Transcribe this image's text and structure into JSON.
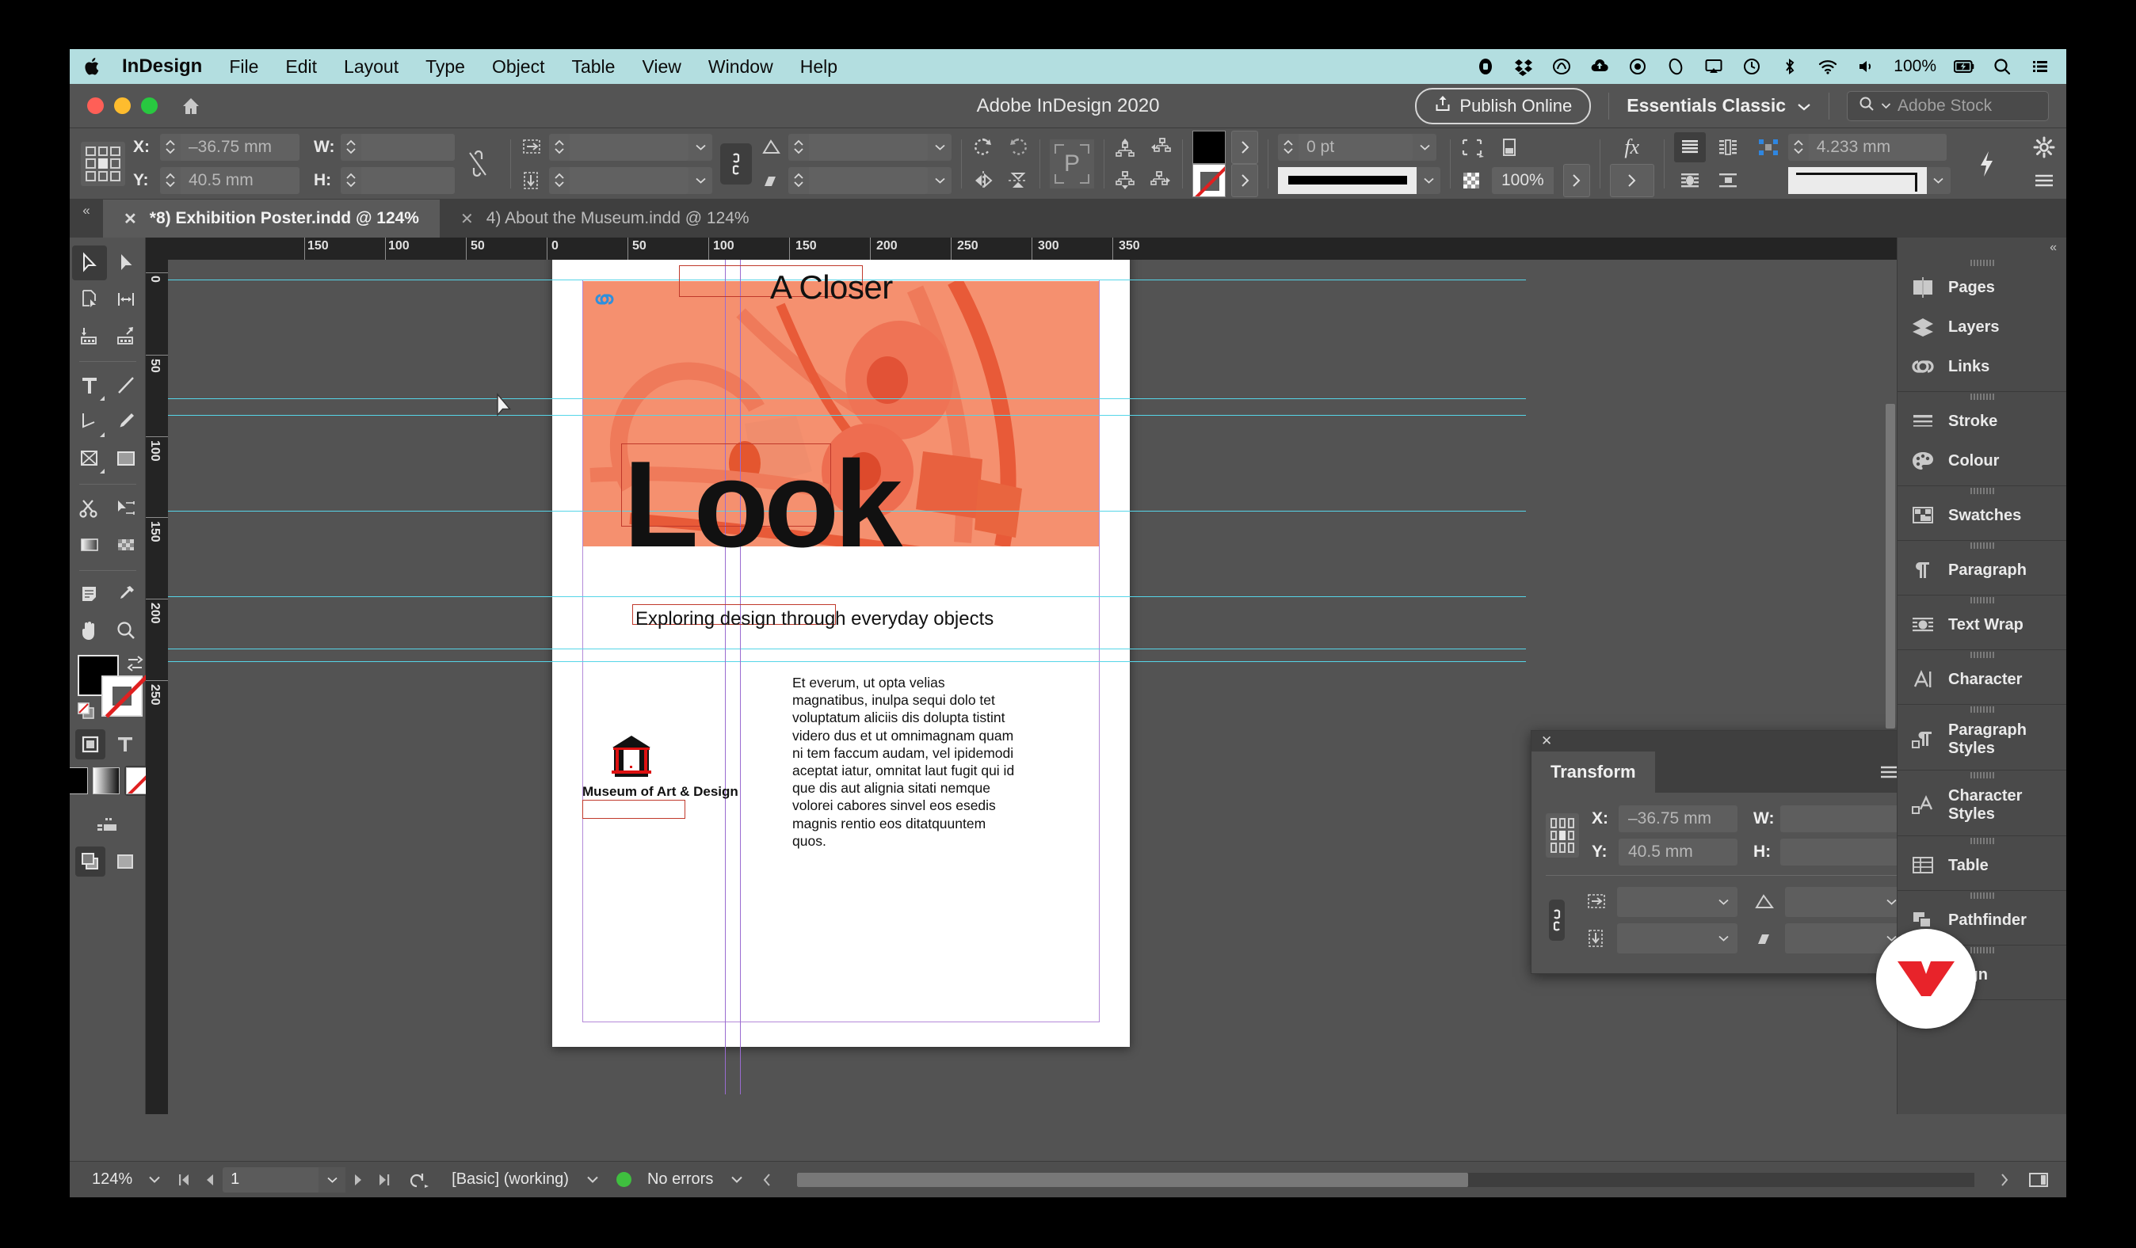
{
  "menubar": {
    "apple_icon": "apple-icon",
    "items": [
      "InDesign",
      "File",
      "Edit",
      "Layout",
      "Type",
      "Object",
      "Table",
      "View",
      "Window",
      "Help"
    ],
    "status_icons": [
      "screen-record-icon",
      "dropbox-icon",
      "creative-cloud-icon",
      "cloud-upload-icon",
      "backup-icon",
      "ellipsis-icon",
      "airplay-icon",
      "time-machine-icon",
      "bluetooth-icon",
      "wifi-icon",
      "volume-icon"
    ],
    "battery_percent": "100%",
    "battery_icon": "battery-charging-icon",
    "search_icon": "spotlight-search-icon",
    "control_center_icon": "control-center-icon"
  },
  "titlebar": {
    "title": "Adobe InDesign 2020",
    "home_icon": "home-icon",
    "publish_label": "Publish Online",
    "publish_icon": "share-upload-icon",
    "workspace": "Essentials Classic",
    "workspace_chevron": "chevron-down-icon",
    "search_placeholder": "Adobe Stock",
    "search_icon": "search-icon"
  },
  "control_panel": {
    "reference_point_icon": "reference-point-proxy",
    "x_label": "X:",
    "x_value": "–36.75 mm",
    "y_label": "Y:",
    "y_value": "40.5 mm",
    "w_label": "W:",
    "w_value": "",
    "h_label": "H:",
    "h_value": "",
    "constrain_wh_icon": "chain-broken-icon",
    "scale_x_icon": "scale-horizontal-icon",
    "scale_y_icon": "scale-vertical-icon",
    "scale_x_value": "",
    "scale_y_value": "",
    "constrain_scale_icon": "chain-link-icon",
    "rotation_icon": "rotation-angle-icon",
    "rotation_value": "",
    "shear_icon": "shear-icon",
    "shear_value": "",
    "rotate_cw_icon": "rotate-clockwise-icon",
    "rotate_ccw_icon": "rotate-counterclockwise-icon",
    "flip_h_icon": "flip-horizontal-icon",
    "flip_v_icon": "flip-vertical-icon",
    "placeholder_icon": "p-placeholder-icon",
    "select_container_icon": "select-container-icon",
    "select_content_icon": "select-content-icon",
    "select_prev_icon": "select-previous-icon",
    "select_next_icon": "select-next-icon",
    "fill_swatch_color": "#000000",
    "stroke_swatch": "none",
    "stroke_weight": "0 pt",
    "stroke_type": "solid-line",
    "opacity": "100%",
    "opacity_icon": "transparency-checker-icon",
    "effects_icon": "fx-icon",
    "text_wrap_none_icon": "wrap-none-icon",
    "text_wrap_bbox_icon": "wrap-bounding-box-icon",
    "text_wrap_shape_icon": "wrap-object-shape-icon",
    "text_wrap_jump_icon": "wrap-jump-object-icon",
    "corner_icon": "corner-options-icon",
    "corner_value": "4.233 mm",
    "corner_shape": "corner-shape-preview",
    "quick_apply_icon": "lightning-quick-apply-icon",
    "gear_icon": "gear-icon",
    "panel_menu_icon": "hamburger-menu-icon"
  },
  "tabs": {
    "collapse_icon": "collapse-chevrons-icon",
    "items": [
      {
        "label": "*8) Exhibition Poster.indd @ 124%",
        "active": true,
        "close_icon": "close-icon"
      },
      {
        "label": "4) About the Museum.indd @ 124%",
        "active": false,
        "close_icon": "close-icon"
      }
    ]
  },
  "toolbox": {
    "tools": [
      [
        "selection-tool",
        "direct-selection-tool"
      ],
      [
        "page-tool",
        "gap-tool"
      ],
      [
        "content-collector-tool",
        "content-placer-tool"
      ],
      [
        "type-tool",
        "line-tool"
      ],
      [
        "pen-tool",
        "pencil-tool"
      ],
      [
        "frame-tool",
        "rectangle-tool"
      ],
      [
        "scissors-tool",
        "free-transform-tool"
      ],
      [
        "gradient-swatch-tool",
        "gradient-feather-tool"
      ],
      [
        "note-tool",
        "eyedropper-tool"
      ],
      [
        "hand-tool",
        "zoom-tool"
      ]
    ],
    "active_tool": "selection-tool",
    "fill_color": "#000000",
    "stroke_color": "none",
    "formatting_affects_container_icon": "affects-container-icon",
    "formatting_affects_text_icon": "affects-text-icon",
    "apply_color_icon": "apply-color-icon",
    "apply_gradient_icon": "apply-gradient-icon",
    "apply_none_icon": "apply-none-icon",
    "screen_mode_icon": "normal-view-mode-icon",
    "preview_mode_icon": "preview-mode-icon"
  },
  "rulers": {
    "horizontal_labels": [
      "150",
      "100",
      "50",
      "0",
      "50",
      "100",
      "150",
      "200",
      "250",
      "300",
      "350"
    ],
    "vertical_labels": [
      "0",
      "50",
      "100",
      "150",
      "200",
      "250"
    ],
    "units": "mm"
  },
  "document": {
    "headline_top": "A Closer",
    "headline_main": "Look",
    "subtitle": "Exploring design through everyday objects",
    "body_text": "Et everum, ut opta velias magnatibus, inulpa sequi dolo tet voluptatum aliciis dis dolupta tistint videro dus et ut omnimagnam quam ni tem faccum audam, vel ipidemodi aceptat iatur, omnitat laut fugit qui id que dis aut alignia sitati nemque volorei cabores sinvel eos esedis magnis rentio eos ditatquuntem quos.",
    "logo_text": "Museum of Art & Design",
    "logo_icon": "museum-building-logo",
    "image_alt": "orange-duotone-wireframe-chair-photo",
    "image_accent_color": "#f58b6e",
    "link_badge_icon": "linked-content-icon",
    "cursor_icon": "mouse-cursor-arrow"
  },
  "transform_panel": {
    "close_icon": "close-icon",
    "collapse_icon": "collapse-chevrons-icon",
    "tab_label": "Transform",
    "menu_icon": "panel-menu-icon",
    "reference_point_icon": "reference-point-proxy",
    "x_label": "X:",
    "x_value": "–36.75 mm",
    "y_label": "Y:",
    "y_value": "40.5 mm",
    "w_label": "W:",
    "w_value": "",
    "h_label": "H:",
    "h_value": "",
    "constrain_icon": "chain-link-icon",
    "scale_x_icon": "scale-horizontal-icon",
    "scale_y_icon": "scale-vertical-icon",
    "rotation_icon": "rotation-angle-icon",
    "shear_icon": "shear-icon"
  },
  "dock": {
    "collapse_icon": "collapse-chevrons-icon",
    "groups": [
      {
        "items": [
          {
            "label": "Pages",
            "icon": "pages-icon"
          },
          {
            "label": "Layers",
            "icon": "layers-icon"
          },
          {
            "label": "Links",
            "icon": "links-chain-icon"
          }
        ]
      },
      {
        "items": [
          {
            "label": "Stroke",
            "icon": "stroke-lines-icon"
          },
          {
            "label": "Colour",
            "icon": "colour-palette-icon"
          }
        ]
      },
      {
        "items": [
          {
            "label": "Swatches",
            "icon": "swatches-grid-icon"
          }
        ]
      },
      {
        "items": [
          {
            "label": "Paragraph",
            "icon": "paragraph-pilcrow-icon"
          }
        ]
      },
      {
        "items": [
          {
            "label": "Text Wrap",
            "icon": "text-wrap-icon"
          }
        ]
      },
      {
        "items": [
          {
            "label": "Character",
            "icon": "character-a-icon"
          }
        ]
      },
      {
        "items": [
          {
            "label": "Paragraph Styles",
            "icon": "paragraph-styles-icon"
          }
        ]
      },
      {
        "items": [
          {
            "label": "Character Styles",
            "icon": "character-styles-icon"
          }
        ]
      },
      {
        "items": [
          {
            "label": "Table",
            "icon": "table-grid-icon"
          }
        ]
      },
      {
        "items": [
          {
            "label": "Pathfinder",
            "icon": "pathfinder-shapes-icon"
          }
        ]
      },
      {
        "items": [
          {
            "label": "Align",
            "icon": "align-left-icon"
          }
        ]
      }
    ]
  },
  "statusbar": {
    "zoom": "124%",
    "zoom_chevron": "chevron-down-icon",
    "first_page_icon": "first-page-icon",
    "prev_page_icon": "previous-page-icon",
    "page_number": "1",
    "page_chevron": "chevron-down-icon",
    "next_page_icon": "next-page-icon",
    "last_page_icon": "last-page-icon",
    "preflight_icon": "preflight-icon",
    "preflight_profile": "[Basic] (working)",
    "preflight_chevron": "chevron-down-icon",
    "error_status": "No errors",
    "error_dot_color": "#3fbf3f",
    "error_chevron": "chevron-down-icon",
    "scroll_left_icon": "scroll-left-icon",
    "scroll_right_icon": "scroll-right-icon",
    "split_window_icon": "split-window-icon"
  }
}
